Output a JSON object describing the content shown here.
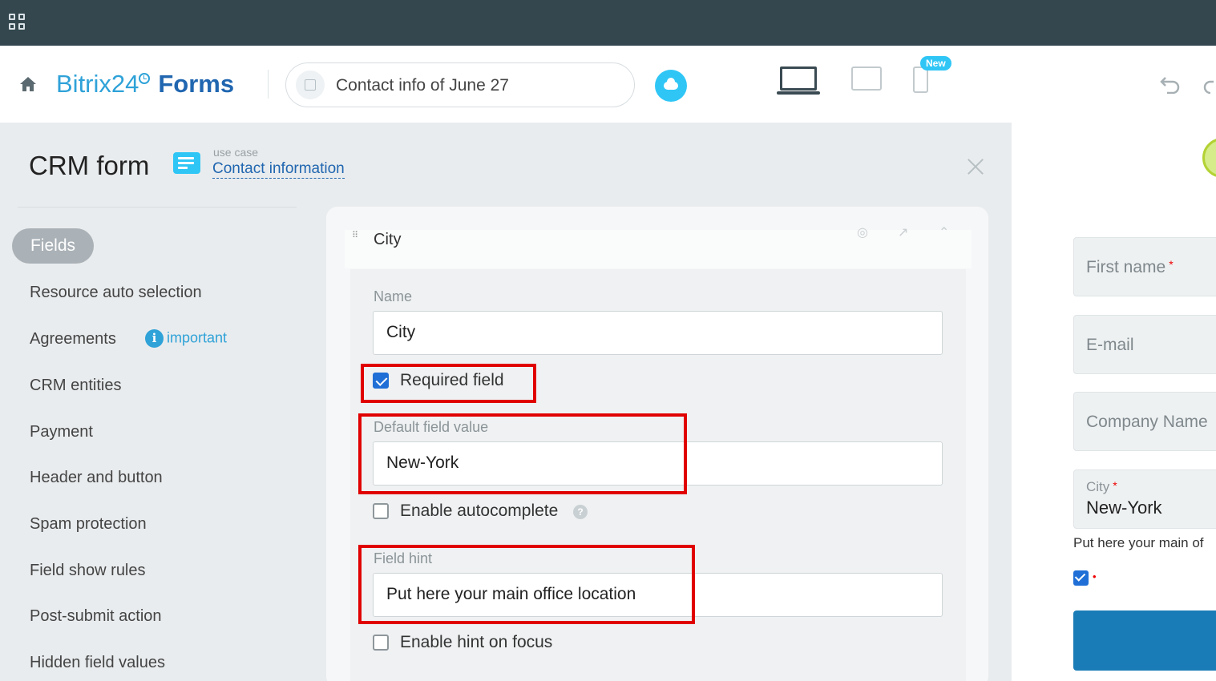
{
  "header": {
    "logo_brand": "Bitrix24",
    "logo_product": "Forms",
    "form_name": "Contact info of June 27",
    "new_badge": "New"
  },
  "panel": {
    "title": "CRM form",
    "use_case_label": "use case",
    "use_case_link": "Contact information"
  },
  "menu": {
    "active": "Fields",
    "items": [
      "Resource auto selection",
      "Agreements",
      "CRM entities",
      "Payment",
      "Header and button",
      "Spam protection",
      "Field show rules",
      "Post-submit action",
      "Hidden field values"
    ],
    "important_badge": "important"
  },
  "field_editor": {
    "title": "City",
    "name_label": "Name",
    "name_value": "City",
    "required_label": "Required field",
    "required_checked": true,
    "default_label": "Default field value",
    "default_value": "New-York",
    "autocomplete_label": "Enable autocomplete",
    "autocomplete_checked": false,
    "hint_label": "Field hint",
    "hint_value": "Put here your main office location",
    "hint_focus_label": "Enable hint on focus",
    "hint_focus_checked": false,
    "help_glyph": "?"
  },
  "preview": {
    "first_name": "First name",
    "email": "E-mail",
    "company": "Company Name",
    "city_label": "City",
    "city_value": "New-York",
    "hint_text": "Put here your main of",
    "required_mark": "*",
    "dot_mark": "•"
  },
  "colors": {
    "accent": "#2fc6f6",
    "brand": "#2066b0",
    "highlight": "#e00000",
    "topbar": "#34474f"
  }
}
